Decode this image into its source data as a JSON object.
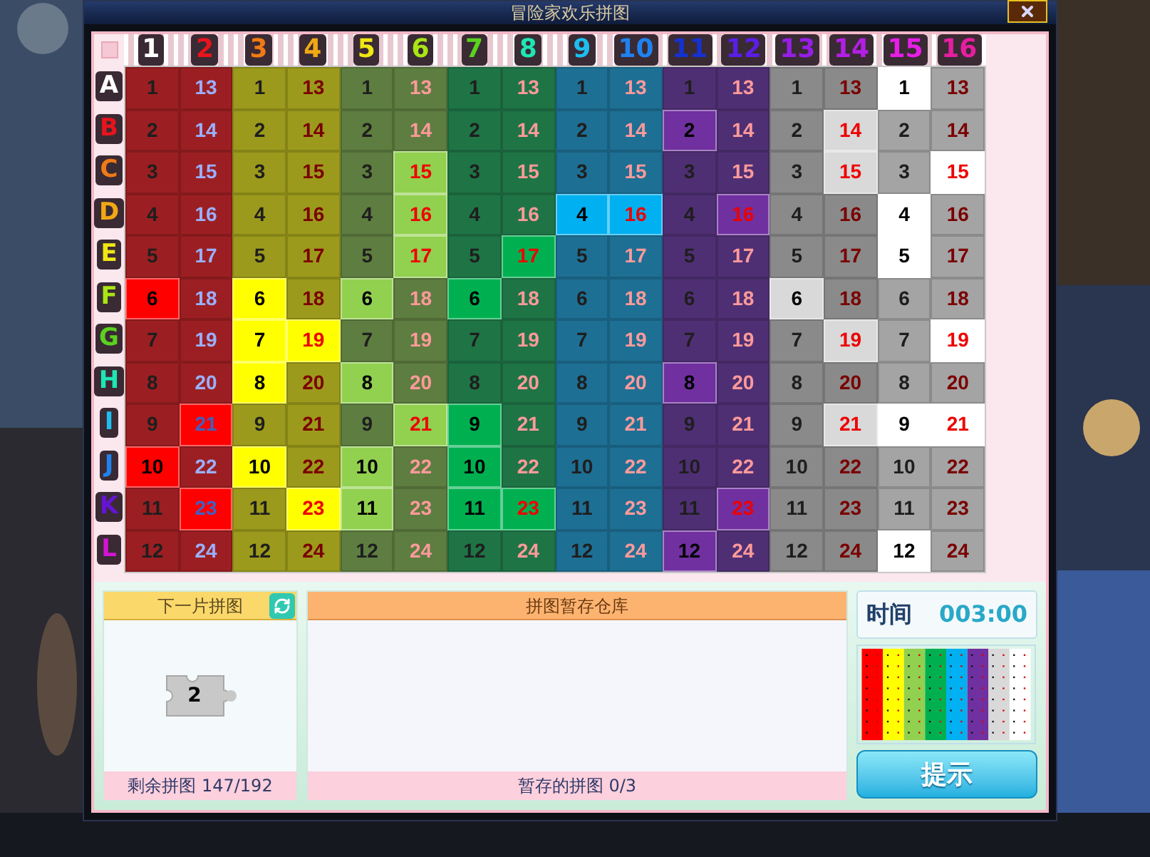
{
  "window": {
    "title": "冒险家欢乐拼图"
  },
  "columns": [
    {
      "label": "1",
      "color": "#ffffff"
    },
    {
      "label": "2",
      "color": "#e8141c"
    },
    {
      "label": "3",
      "color": "#f07a14"
    },
    {
      "label": "4",
      "color": "#f0a814"
    },
    {
      "label": "5",
      "color": "#f0e614"
    },
    {
      "label": "6",
      "color": "#a8e614"
    },
    {
      "label": "7",
      "color": "#5ad21e"
    },
    {
      "label": "8",
      "color": "#1ee6b4"
    },
    {
      "label": "9",
      "color": "#1ebef0"
    },
    {
      "label": "10",
      "color": "#1e82f0"
    },
    {
      "label": "11",
      "color": "#1432d2"
    },
    {
      "label": "12",
      "color": "#5a1ee6"
    },
    {
      "label": "13",
      "color": "#961ee6"
    },
    {
      "label": "14",
      "color": "#b41ee6"
    },
    {
      "label": "15",
      "color": "#e61ee6"
    },
    {
      "label": "16",
      "color": "#e61ea0"
    }
  ],
  "rows": [
    {
      "label": "A",
      "color": "#ffffff",
      "cells": [
        {
          "text": "1",
          "placed": false
        },
        {
          "text": "13",
          "placed": false
        },
        {
          "text": "1",
          "placed": false
        },
        {
          "text": "13",
          "placed": false
        },
        {
          "text": "1",
          "placed": false
        },
        {
          "text": "13",
          "placed": false
        },
        {
          "text": "1",
          "placed": false
        },
        {
          "text": "13",
          "placed": false
        },
        {
          "text": "1",
          "placed": false
        },
        {
          "text": "13",
          "placed": false
        },
        {
          "text": "1",
          "placed": false
        },
        {
          "text": "13",
          "placed": false
        },
        {
          "text": "1",
          "placed": false
        },
        {
          "text": "13",
          "placed": false
        },
        {
          "text": "1",
          "placed": true
        },
        {
          "text": "13",
          "placed": false
        }
      ]
    },
    {
      "label": "B",
      "color": "#e8141c",
      "cells": [
        {
          "text": "2",
          "placed": false
        },
        {
          "text": "14",
          "placed": false
        },
        {
          "text": "2",
          "placed": false
        },
        {
          "text": "14",
          "placed": false
        },
        {
          "text": "2",
          "placed": false
        },
        {
          "text": "14",
          "placed": false
        },
        {
          "text": "2",
          "placed": false
        },
        {
          "text": "14",
          "placed": false
        },
        {
          "text": "2",
          "placed": false
        },
        {
          "text": "14",
          "placed": false
        },
        {
          "text": "2",
          "placed": true
        },
        {
          "text": "14",
          "placed": false
        },
        {
          "text": "2",
          "placed": false
        },
        {
          "text": "14",
          "placed": true
        },
        {
          "text": "2",
          "placed": false
        },
        {
          "text": "14",
          "placed": false
        }
      ]
    },
    {
      "label": "C",
      "color": "#f07a14",
      "cells": [
        {
          "text": "3",
          "placed": false
        },
        {
          "text": "15",
          "placed": false
        },
        {
          "text": "3",
          "placed": false
        },
        {
          "text": "15",
          "placed": false
        },
        {
          "text": "3",
          "placed": false
        },
        {
          "text": "15",
          "placed": true
        },
        {
          "text": "3",
          "placed": false
        },
        {
          "text": "15",
          "placed": false
        },
        {
          "text": "3",
          "placed": false
        },
        {
          "text": "15",
          "placed": false
        },
        {
          "text": "3",
          "placed": false
        },
        {
          "text": "15",
          "placed": false
        },
        {
          "text": "3",
          "placed": false
        },
        {
          "text": "15",
          "placed": true
        },
        {
          "text": "3",
          "placed": false
        },
        {
          "text": "15",
          "placed": true
        }
      ]
    },
    {
      "label": "D",
      "color": "#f0a814",
      "cells": [
        {
          "text": "4",
          "placed": false
        },
        {
          "text": "16",
          "placed": false
        },
        {
          "text": "4",
          "placed": false
        },
        {
          "text": "16",
          "placed": false
        },
        {
          "text": "4",
          "placed": false
        },
        {
          "text": "16",
          "placed": true
        },
        {
          "text": "4",
          "placed": false
        },
        {
          "text": "16",
          "placed": false
        },
        {
          "text": "4",
          "placed": true
        },
        {
          "text": "16",
          "placed": true
        },
        {
          "text": "4",
          "placed": false
        },
        {
          "text": "16",
          "placed": true
        },
        {
          "text": "4",
          "placed": false
        },
        {
          "text": "16",
          "placed": false
        },
        {
          "text": "4",
          "placed": true
        },
        {
          "text": "16",
          "placed": false
        }
      ]
    },
    {
      "label": "E",
      "color": "#f0e614",
      "cells": [
        {
          "text": "5",
          "placed": false
        },
        {
          "text": "17",
          "placed": false
        },
        {
          "text": "5",
          "placed": false
        },
        {
          "text": "17",
          "placed": false
        },
        {
          "text": "5",
          "placed": false
        },
        {
          "text": "17",
          "placed": true
        },
        {
          "text": "5",
          "placed": false
        },
        {
          "text": "17",
          "placed": true
        },
        {
          "text": "5",
          "placed": false
        },
        {
          "text": "17",
          "placed": false
        },
        {
          "text": "5",
          "placed": false
        },
        {
          "text": "17",
          "placed": false
        },
        {
          "text": "5",
          "placed": false
        },
        {
          "text": "17",
          "placed": false
        },
        {
          "text": "5",
          "placed": true
        },
        {
          "text": "17",
          "placed": false
        }
      ]
    },
    {
      "label": "F",
      "color": "#a8e614",
      "cells": [
        {
          "text": "6",
          "placed": true
        },
        {
          "text": "18",
          "placed": false
        },
        {
          "text": "6",
          "placed": true
        },
        {
          "text": "18",
          "placed": false
        },
        {
          "text": "6",
          "placed": true
        },
        {
          "text": "18",
          "placed": false
        },
        {
          "text": "6",
          "placed": true
        },
        {
          "text": "18",
          "placed": false
        },
        {
          "text": "6",
          "placed": false
        },
        {
          "text": "18",
          "placed": false
        },
        {
          "text": "6",
          "placed": false
        },
        {
          "text": "18",
          "placed": false
        },
        {
          "text": "6",
          "placed": true
        },
        {
          "text": "18",
          "placed": false
        },
        {
          "text": "6",
          "placed": false
        },
        {
          "text": "18",
          "placed": false
        }
      ]
    },
    {
      "label": "G",
      "color": "#5ad21e",
      "cells": [
        {
          "text": "7",
          "placed": false
        },
        {
          "text": "19",
          "placed": false
        },
        {
          "text": "7",
          "placed": true
        },
        {
          "text": "19",
          "placed": true
        },
        {
          "text": "7",
          "placed": false
        },
        {
          "text": "19",
          "placed": false
        },
        {
          "text": "7",
          "placed": false
        },
        {
          "text": "19",
          "placed": false
        },
        {
          "text": "7",
          "placed": false
        },
        {
          "text": "19",
          "placed": false
        },
        {
          "text": "7",
          "placed": false
        },
        {
          "text": "19",
          "placed": false
        },
        {
          "text": "7",
          "placed": false
        },
        {
          "text": "19",
          "placed": true
        },
        {
          "text": "7",
          "placed": false
        },
        {
          "text": "19",
          "placed": true
        }
      ]
    },
    {
      "label": "H",
      "color": "#1ee6b4",
      "cells": [
        {
          "text": "8",
          "placed": false
        },
        {
          "text": "20",
          "placed": false
        },
        {
          "text": "8",
          "placed": true
        },
        {
          "text": "20",
          "placed": false
        },
        {
          "text": "8",
          "placed": true
        },
        {
          "text": "20",
          "placed": false
        },
        {
          "text": "8",
          "placed": false
        },
        {
          "text": "20",
          "placed": false
        },
        {
          "text": "8",
          "placed": false
        },
        {
          "text": "20",
          "placed": false
        },
        {
          "text": "8",
          "placed": true
        },
        {
          "text": "20",
          "placed": false
        },
        {
          "text": "8",
          "placed": false
        },
        {
          "text": "20",
          "placed": false
        },
        {
          "text": "8",
          "placed": false
        },
        {
          "text": "20",
          "placed": false
        }
      ]
    },
    {
      "label": "I",
      "color": "#1ebef0",
      "cells": [
        {
          "text": "9",
          "placed": false
        },
        {
          "text": "21",
          "placed": true
        },
        {
          "text": "9",
          "placed": false
        },
        {
          "text": "21",
          "placed": false
        },
        {
          "text": "9",
          "placed": false
        },
        {
          "text": "21",
          "placed": true
        },
        {
          "text": "9",
          "placed": true
        },
        {
          "text": "21",
          "placed": false
        },
        {
          "text": "9",
          "placed": false
        },
        {
          "text": "21",
          "placed": false
        },
        {
          "text": "9",
          "placed": false
        },
        {
          "text": "21",
          "placed": false
        },
        {
          "text": "9",
          "placed": false
        },
        {
          "text": "21",
          "placed": true
        },
        {
          "text": "9",
          "placed": true
        },
        {
          "text": "21",
          "placed": true
        }
      ]
    },
    {
      "label": "J",
      "color": "#1e82f0",
      "cells": [
        {
          "text": "10",
          "placed": true
        },
        {
          "text": "22",
          "placed": false
        },
        {
          "text": "10",
          "placed": true
        },
        {
          "text": "22",
          "placed": false
        },
        {
          "text": "10",
          "placed": true
        },
        {
          "text": "22",
          "placed": false
        },
        {
          "text": "10",
          "placed": true
        },
        {
          "text": "22",
          "placed": false
        },
        {
          "text": "10",
          "placed": false
        },
        {
          "text": "22",
          "placed": false
        },
        {
          "text": "10",
          "placed": false
        },
        {
          "text": "22",
          "placed": false
        },
        {
          "text": "10",
          "placed": false
        },
        {
          "text": "22",
          "placed": false
        },
        {
          "text": "10",
          "placed": false
        },
        {
          "text": "22",
          "placed": false
        }
      ]
    },
    {
      "label": "K",
      "color": "#6414d2",
      "cells": [
        {
          "text": "11",
          "placed": false
        },
        {
          "text": "23",
          "placed": true
        },
        {
          "text": "11",
          "placed": false
        },
        {
          "text": "23",
          "placed": true
        },
        {
          "text": "11",
          "placed": true
        },
        {
          "text": "23",
          "placed": false
        },
        {
          "text": "11",
          "placed": true
        },
        {
          "text": "23",
          "placed": true
        },
        {
          "text": "11",
          "placed": false
        },
        {
          "text": "23",
          "placed": false
        },
        {
          "text": "11",
          "placed": false
        },
        {
          "text": "23",
          "placed": true
        },
        {
          "text": "11",
          "placed": false
        },
        {
          "text": "23",
          "placed": false
        },
        {
          "text": "11",
          "placed": false
        },
        {
          "text": "23",
          "placed": false
        }
      ]
    },
    {
      "label": "L",
      "color": "#d214d2",
      "cells": [
        {
          "text": "12",
          "placed": false
        },
        {
          "text": "24",
          "placed": false
        },
        {
          "text": "12",
          "placed": false
        },
        {
          "text": "24",
          "placed": false
        },
        {
          "text": "12",
          "placed": false
        },
        {
          "text": "24",
          "placed": false
        },
        {
          "text": "12",
          "placed": false
        },
        {
          "text": "24",
          "placed": false
        },
        {
          "text": "12",
          "placed": false
        },
        {
          "text": "24",
          "placed": false
        },
        {
          "text": "12",
          "placed": true
        },
        {
          "text": "24",
          "placed": false
        },
        {
          "text": "12",
          "placed": false
        },
        {
          "text": "24",
          "placed": false
        },
        {
          "text": "12",
          "placed": true
        },
        {
          "text": "24",
          "placed": false
        }
      ]
    }
  ],
  "next_piece": {
    "title": "下一片拼图",
    "piece": "2",
    "footer": "剩余拼图 147/192"
  },
  "storage": {
    "title": "拼图暂存仓库",
    "footer": "暂存的拼图 0/3"
  },
  "timer": {
    "label": "时间",
    "value": "003:00"
  },
  "hint_button": "提示"
}
